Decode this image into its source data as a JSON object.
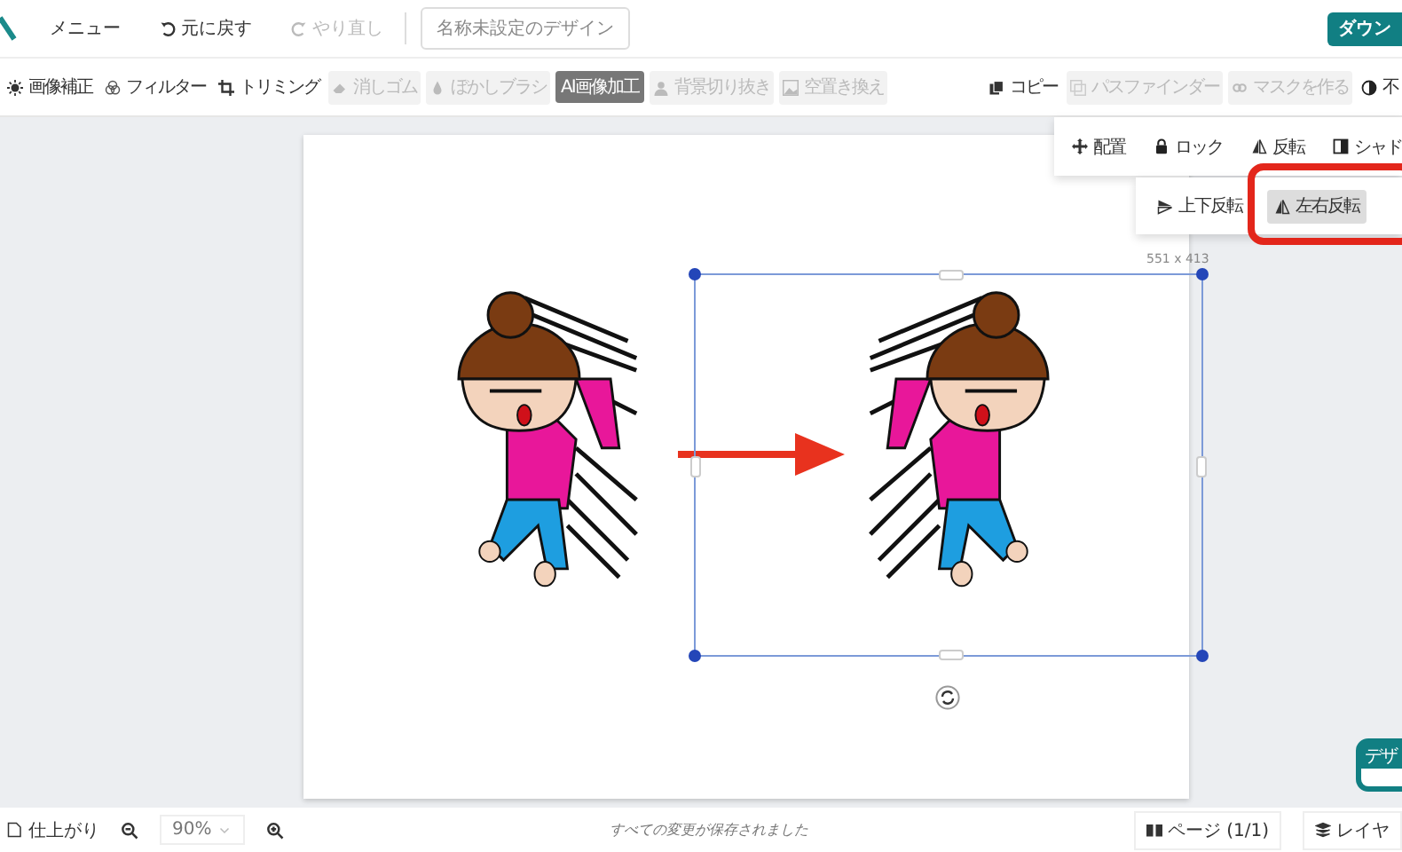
{
  "top_bar": {
    "menu": "メニュー",
    "undo": {
      "label": "元に戻す",
      "disabled": false
    },
    "redo": {
      "label": "やり直し",
      "disabled": true
    },
    "design_title": "名称未設定のデザイン",
    "download": "ダウン"
  },
  "toolbar": [
    {
      "kind": "tool",
      "label": "画像補正",
      "disabled": false
    },
    {
      "kind": "tool",
      "label": "フィルター",
      "disabled": false
    },
    {
      "kind": "tool",
      "label": "トリミング",
      "disabled": false
    },
    {
      "kind": "tool",
      "label": "消しゴム",
      "disabled": true
    },
    {
      "kind": "tool",
      "label": "ぼかしブラシ",
      "disabled": true
    },
    {
      "kind": "badge",
      "label": "AI画像加工"
    },
    {
      "kind": "tool",
      "label": "背景切り抜き",
      "disabled": true
    },
    {
      "kind": "tool",
      "label": "空置き換え",
      "disabled": true
    },
    {
      "kind": "spacer"
    },
    {
      "kind": "tool",
      "label": "コピー",
      "disabled": false
    },
    {
      "kind": "tool",
      "label": "パスファインダー",
      "disabled": true
    },
    {
      "kind": "tool",
      "label": "マスクを作る",
      "disabled": true
    },
    {
      "kind": "tool",
      "label": "不",
      "disabled": false
    }
  ],
  "canvas": {
    "selection_size": "551 x 413"
  },
  "arrange_menu": [
    {
      "label": "配置"
    },
    {
      "label": "ロック"
    },
    {
      "label": "反転"
    },
    {
      "label": "シャド"
    }
  ],
  "flip_menu": [
    {
      "label": "上下反転",
      "selected": false
    },
    {
      "label": "左右反転",
      "selected": true
    }
  ],
  "design_badge": "デザ",
  "status_bar": {
    "finish": "仕上がり",
    "zoom": "90%",
    "save_status": "すべての変更が保存されました",
    "pages": "ページ (1/1)",
    "layers": "レイヤ"
  }
}
